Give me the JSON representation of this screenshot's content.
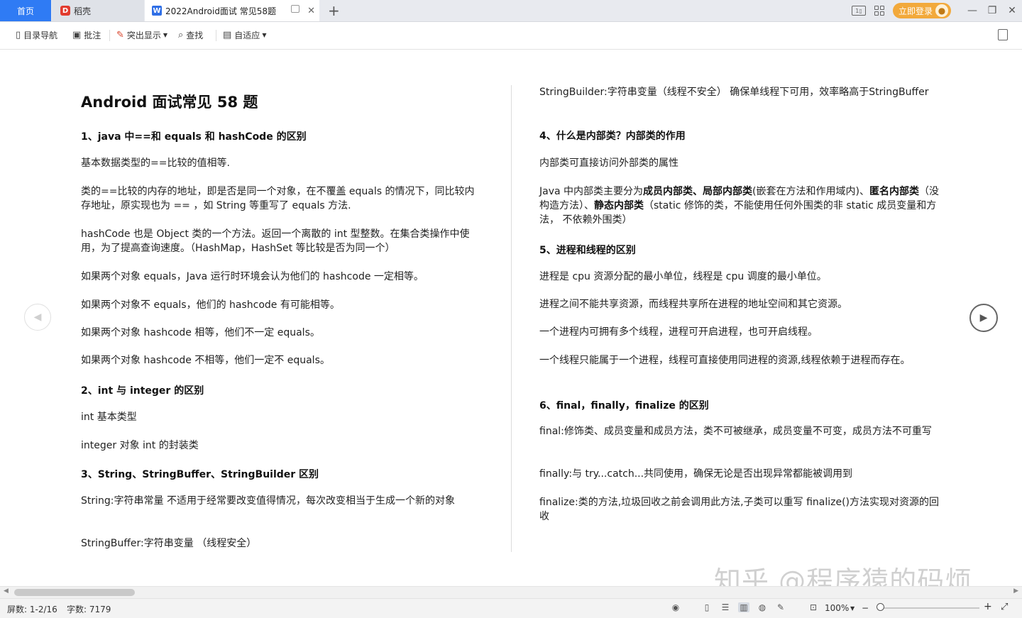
{
  "tabs": {
    "home": "首页",
    "daoke": "稻壳",
    "doc": "2022Android面试 常见58题"
  },
  "header_right": {
    "login": "立即登录"
  },
  "toolbar": {
    "nav": "目录导航",
    "annotate": "批注",
    "highlight": "突出显示",
    "find": "查找",
    "fit": "自适应"
  },
  "document": {
    "title": "Android 面试常见 58 题",
    "left": {
      "h1": "1、java 中==和 equals 和 hashCode 的区别",
      "p1": "基本数据类型的==比较的值相等.",
      "p2": "类的==比较的内存的地址，即是否是同一个对象，在不覆盖 equals 的情况下，同比较内存地址，原实现也为 == ，如 String 等重写了 equals 方法.",
      "p3": "hashCode 也是 Object 类的一个方法。返回一个离散的 int 型整数。在集合类操作中使用，为了提高查询速度。（HashMap，HashSet 等比较是否为同一个）",
      "p4": "如果两个对象 equals，Java 运行时环境会认为他们的 hashcode 一定相等。",
      "p5": "如果两个对象不 equals，他们的 hashcode 有可能相等。",
      "p6": "如果两个对象 hashcode 相等，他们不一定 equals。",
      "p7": "如果两个对象 hashcode 不相等，他们一定不 equals。",
      "h2": "2、int 与 integer 的区别",
      "p8": "int  基本类型",
      "p9": "integer  对象  int 的封装类",
      "h3": "3、String、StringBuffer、StringBuilder 区别",
      "p10": "String:字符串常量  不适用于经常要改变值得情况，每次改变相当于生成一个新的对象",
      "p11": "StringBuffer:字符串变量  （线程安全）"
    },
    "right": {
      "p1": "StringBuilder:字符串变量（线程不安全）  确保单线程下可用，效率略高于StringBuffer",
      "h4": "4、什么是内部类？内部类的作用",
      "p2": "内部类可直接访问外部类的属性",
      "p3a": "Java 中内部类主要分为",
      "p3b": "成员内部类",
      "p3c": "、",
      "p3d": "局部内部类",
      "p3e": "(嵌套在方法和作用域内)、",
      "p3f": "匿名内部类",
      "p3g": "（没构造方法）、",
      "p3h": "静态内部类",
      "p3i": "（static 修饰的类，不能使用任何外围类的非 static 成员变量和方法，  不依赖外围类）",
      "h5": "5、进程和线程的区别",
      "p4": "进程是 cpu 资源分配的最小单位，线程是 cpu 调度的最小单位。",
      "p5": "进程之间不能共享资源，而线程共享所在进程的地址空间和其它资源。",
      "p6": "一个进程内可拥有多个线程，进程可开启进程，也可开启线程。",
      "p7": "一个线程只能属于一个进程，线程可直接使用同进程的资源,线程依赖于进程而存在。",
      "h6": "6、final，finally，finalize 的区别",
      "p8": "final:修饰类、成员变量和成员方法，类不可被继承，成员变量不可变，成员方法不可重写",
      "p9": "finally:与 try...catch...共同使用，确保无论是否出现异常都能被调用到",
      "p10": "finalize:类的方法,垃圾回收之前会调用此方法,子类可以重写 finalize()方法实现对资源的回收"
    }
  },
  "watermark": "知乎 @程序猿的码烦",
  "status": {
    "pages": "屏数: 1-2/16",
    "words": "字数: 7179",
    "zoom": "100%"
  }
}
